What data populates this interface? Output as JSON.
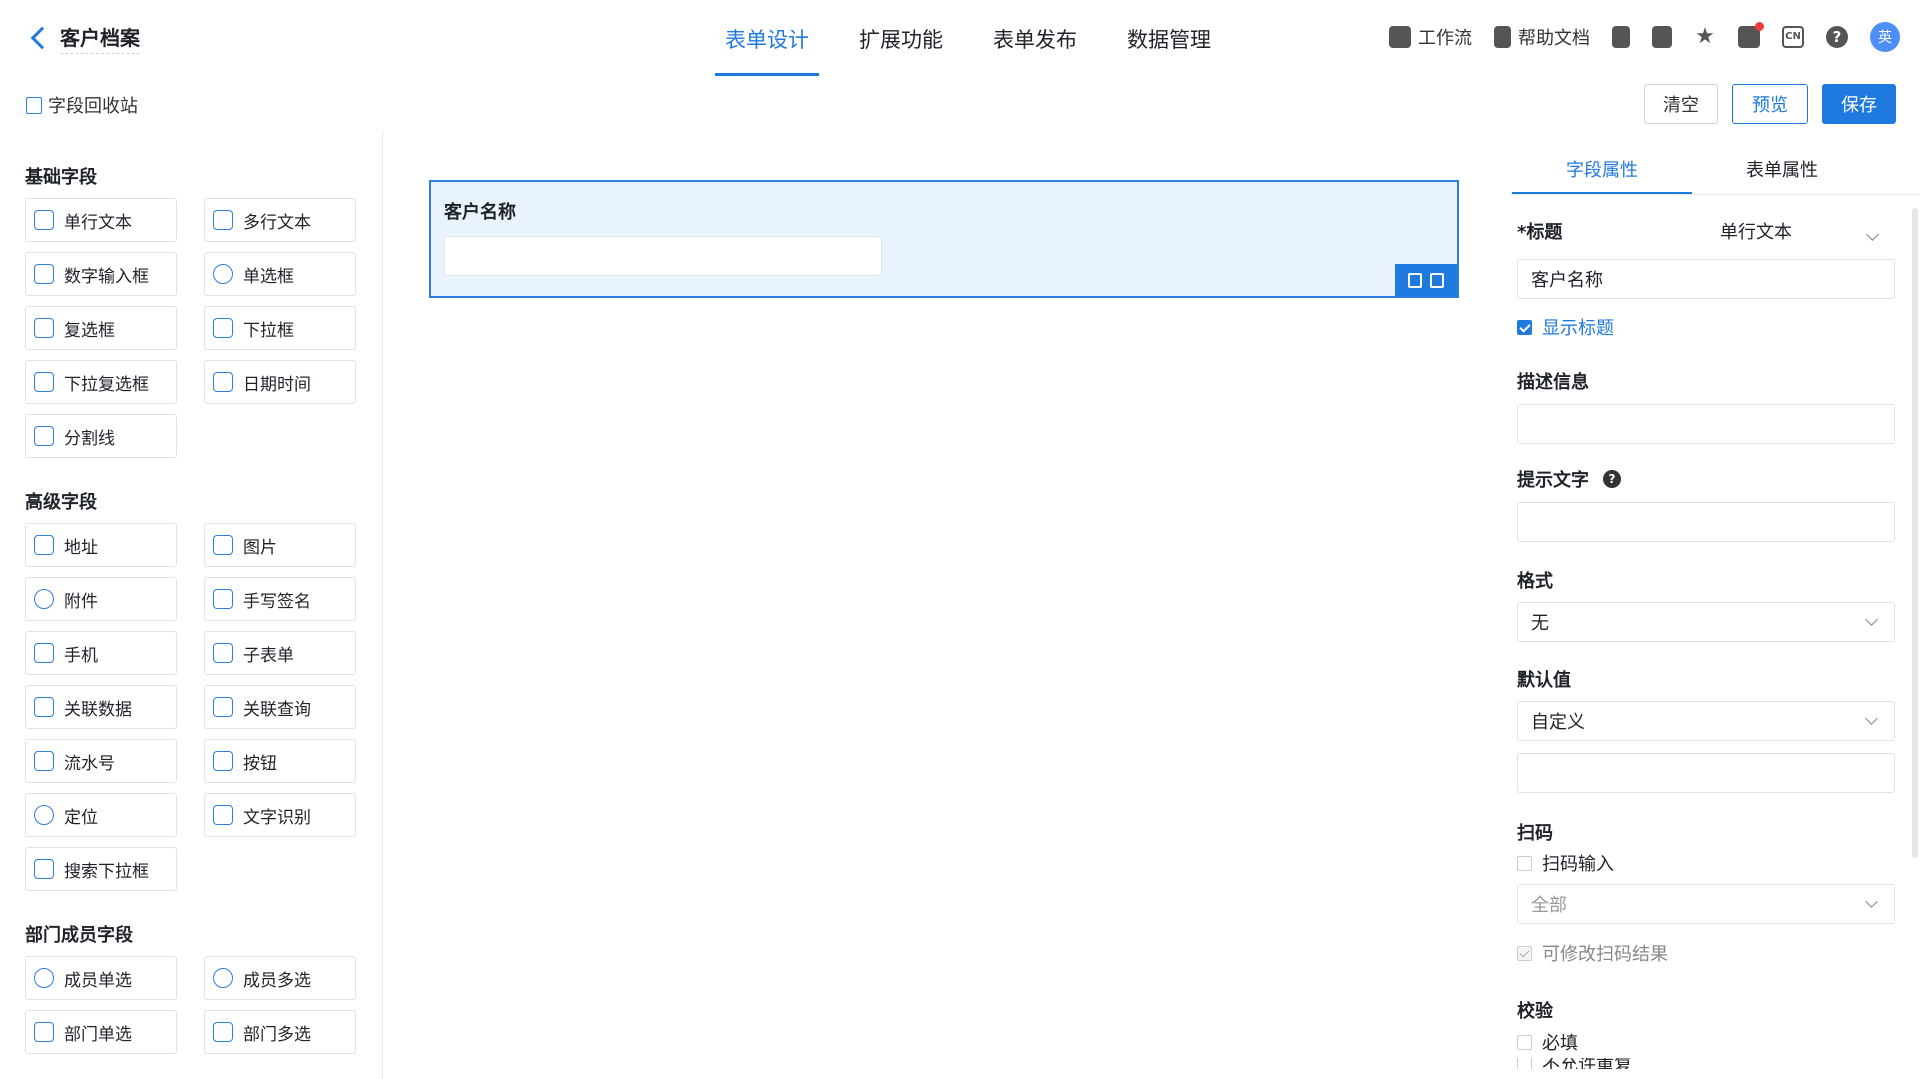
{
  "header": {
    "back_title": "客户档案",
    "tabs": [
      "表单设计",
      "扩展功能",
      "表单发布",
      "数据管理"
    ],
    "workflow": "工作流",
    "help": "帮助文档",
    "avatar": "英"
  },
  "recycle": "字段回收站",
  "toolbar": {
    "clear": "清空",
    "preview": "预览",
    "save": "保存"
  },
  "sidebar": {
    "basic_title": "基础字段",
    "basic": [
      "单行文本",
      "多行文本",
      "数字输入框",
      "单选框",
      "复选框",
      "下拉框",
      "下拉复选框",
      "日期时间",
      "分割线"
    ],
    "advanced_title": "高级字段",
    "advanced": [
      "地址",
      "图片",
      "附件",
      "手写签名",
      "手机",
      "子表单",
      "关联数据",
      "关联查询",
      "流水号",
      "按钮",
      "定位",
      "文字识别",
      "搜索下拉框"
    ],
    "dept_title": "部门成员字段",
    "dept": [
      "成员单选",
      "成员多选",
      "部门单选",
      "部门多选"
    ]
  },
  "canvas": {
    "field_label": "客户名称"
  },
  "props": {
    "tab_field": "字段属性",
    "tab_form": "表单属性",
    "title_label": "*标题",
    "type_value": "单行文本",
    "title_value": "客户名称",
    "show_title": "显示标题",
    "desc_label": "描述信息",
    "hint_label": "提示文字",
    "format_label": "格式",
    "format_value": "无",
    "default_label": "默认值",
    "default_value": "自定义",
    "scan_label": "扫码",
    "scan_input": "扫码输入",
    "scan_scope": "全部",
    "scan_edit": "可修改扫码结果",
    "validate_label": "校验",
    "required": "必填",
    "no_dup": "不允许重复"
  },
  "colors": {
    "accent": "#1f7ae0",
    "selected_bg": "#e8f3fd"
  }
}
